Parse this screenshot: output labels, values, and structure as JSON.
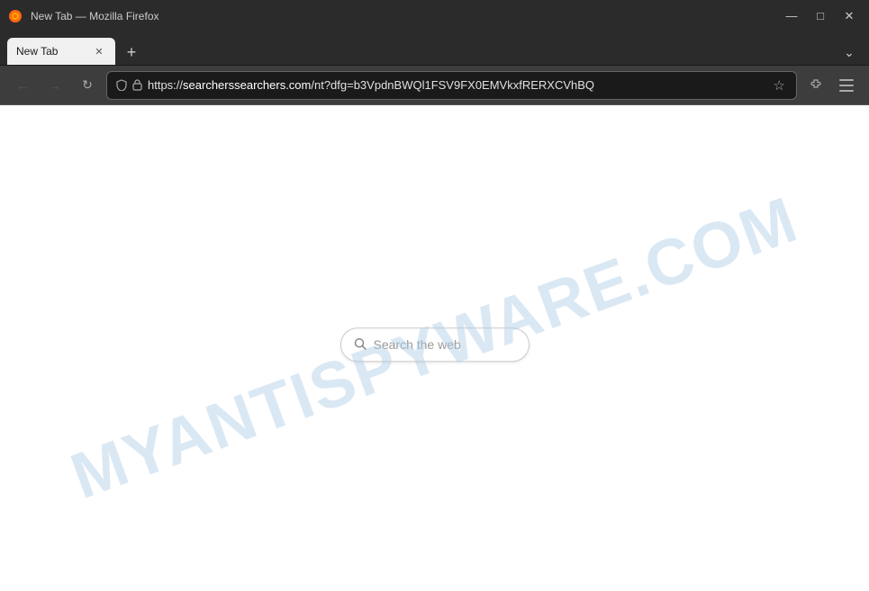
{
  "titleBar": {
    "title": "New Tab — Mozilla Firefox",
    "minimize": "—",
    "maximize": "□",
    "close": "✕"
  },
  "tabBar": {
    "activeTab": {
      "title": "New Tab",
      "closeBtn": "✕"
    },
    "newTabBtn": "+",
    "tabListBtn": "⌄"
  },
  "navBar": {
    "backBtn": "←",
    "forwardBtn": "→",
    "refreshBtn": "↻",
    "url": "https://searcherssearchers.com/nt?dfg=b3VpdnBWQl1FSV9FX0EMVkxfRERXCVhBQ",
    "urlDisplay": "https://searcherssearchers.com/nt?dfg=b3VpdnBWQl1FSV9FX0EMVkxfRERXCVhBQ",
    "urlBold": "searcherssearchers.com",
    "starBtn": "☆",
    "extensionsBtn": "🧩",
    "menuBtn": "≡",
    "lockIcon": "🔒",
    "shieldIcon": "🛡"
  },
  "mainContent": {
    "searchBox": {
      "placeholder": "Search the web",
      "searchIconUnicode": "🔍"
    },
    "watermark": "MYANTISPYWARE.COM"
  }
}
